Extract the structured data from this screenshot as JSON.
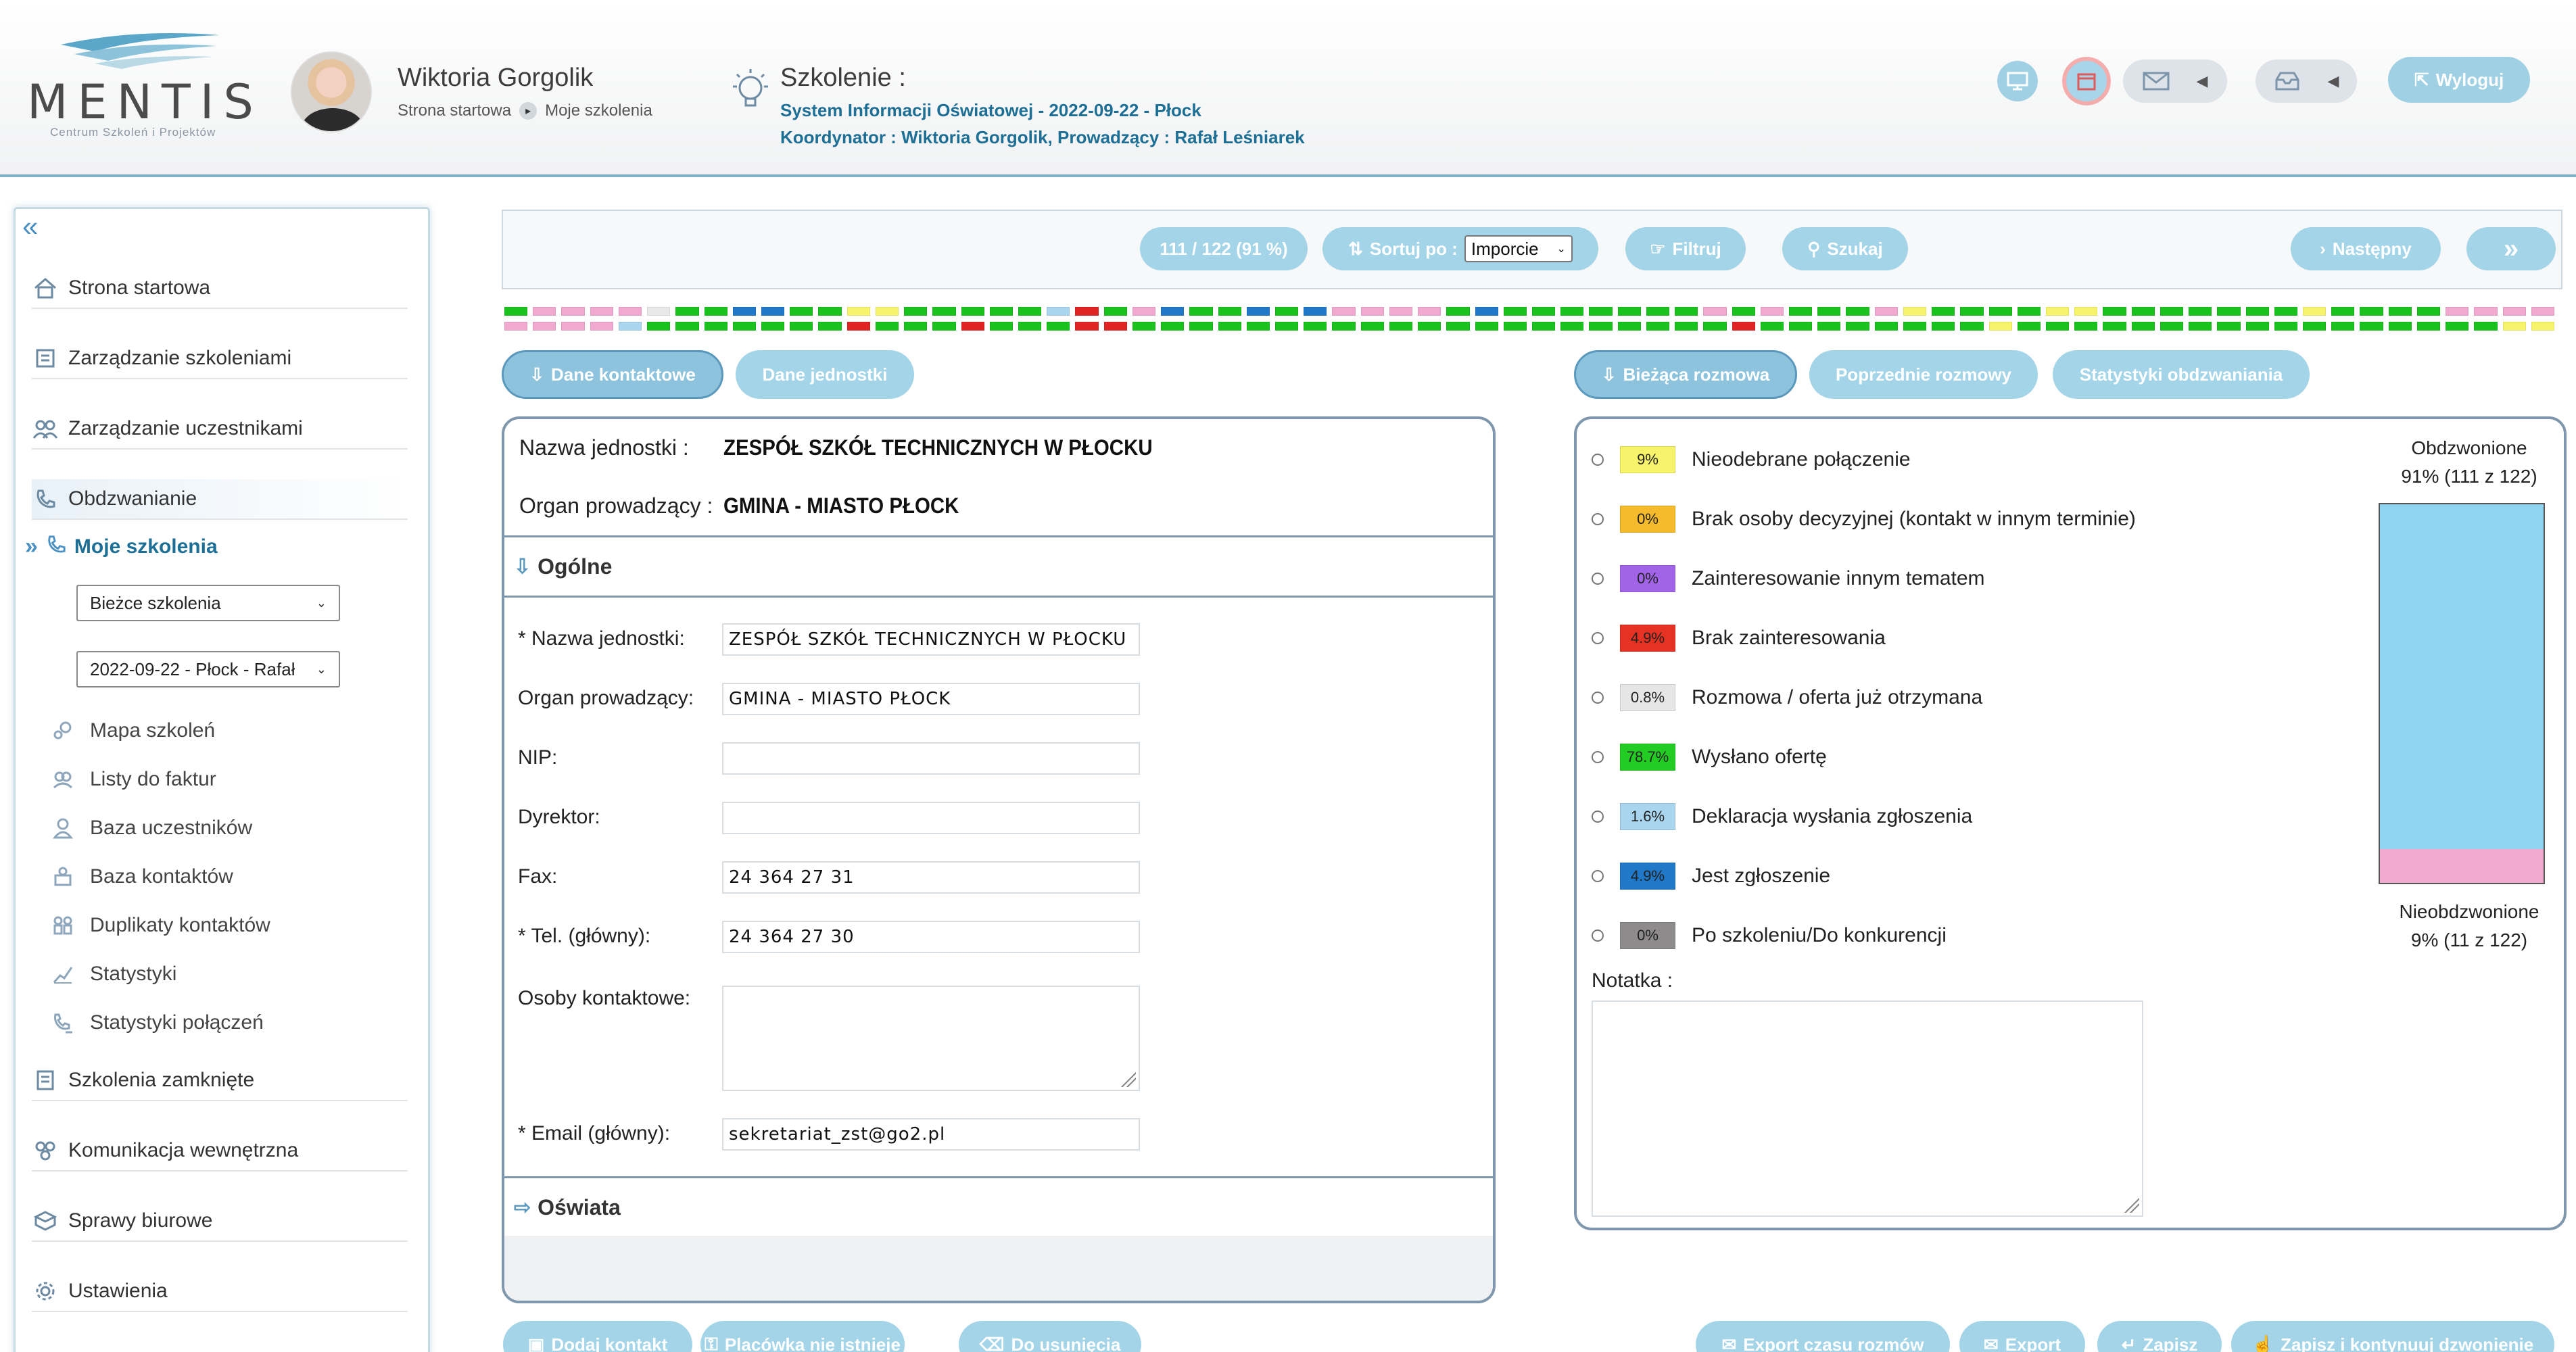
{
  "header": {
    "logo": {
      "word": "MENTIS",
      "tagline": "Centrum Szkoleń i Projektów"
    },
    "user": {
      "name": "Wiktoria Gorgolik",
      "crumbs": [
        "Strona startowa",
        "Moje szkolenia"
      ]
    },
    "course": {
      "label": "Szkolenie :",
      "name": "System Informacji Oświatowej - 2022-09-22 - Płock",
      "coordinator": "Koordynator : Wiktoria Gorgolik, Prowadzący : Rafał Leśniarek"
    },
    "icons": [
      "monitor-icon",
      "calendar-icon",
      "mail-icon",
      "chevron-left-icon",
      "inbox-icon",
      "chevron-left-icon"
    ],
    "logout_label": "Wyloguj"
  },
  "sidebar": {
    "items": [
      {
        "label": "Strona startowa",
        "icon": "home-icon"
      },
      {
        "label": "Zarządzanie szkoleniami",
        "icon": "book-icon"
      },
      {
        "label": "Zarządzanie uczestnikami",
        "icon": "users-icon"
      },
      {
        "label": "Obdzwanianie",
        "icon": "phone-icon"
      }
    ],
    "current": "Moje szkolenia",
    "select_scope": "Bieżce szkolenia",
    "select_course": "2022-09-22 - Płock - Rafał",
    "sub_items": [
      {
        "label": "Mapa szkoleń",
        "icon": "map-icon"
      },
      {
        "label": "Listy do faktur",
        "icon": "list-icon"
      },
      {
        "label": "Baza uczestników",
        "icon": "person-icon"
      },
      {
        "label": "Baza kontaktów",
        "icon": "contacts-icon"
      },
      {
        "label": "Duplikaty kontaktów",
        "icon": "duplicate-icon"
      },
      {
        "label": "Statystyki",
        "icon": "chart-icon"
      },
      {
        "label": "Statystyki połączeń",
        "icon": "call-stats-icon"
      }
    ],
    "bottom_items": [
      {
        "label": "Szkolenia zamknięte",
        "icon": "archive-icon"
      },
      {
        "label": "Komunikacja wewnętrzna",
        "icon": "chat-icon"
      },
      {
        "label": "Sprawy biurowe",
        "icon": "box-icon"
      },
      {
        "label": "Ustawienia",
        "icon": "gear-icon"
      }
    ]
  },
  "toolbar": {
    "progress": "111 / 122 (91 %)",
    "sort_label": "Sortuj po :",
    "sort_value": "Imporcie",
    "filter_label": "Filtruj",
    "search_label": "Szukaj",
    "next_label": "Następny"
  },
  "strip": {
    "colors": {
      "g": "#19c21c",
      "p": "#f2a9cf",
      "w": "#e9e9e9",
      "b": "#1f78c8",
      "y": "#f7f36b",
      "l": "#a9d5ef",
      "r": "#e02424"
    },
    "row1": "gppppwggbbggyyggggglrgpbggbgbppppgbgggggggpgpgggpyggggyygggggggyggggppppgpg",
    "row2": "pppplgggggggrgggrgggrrgggggggggggggggggggggrggggggggygggggggggggggggggyybgg"
  },
  "tabs": {
    "left": [
      "Dane kontaktowe",
      "Dane jednostki"
    ],
    "right": [
      "Bieżąca rozmowa",
      "Poprzednie rozmowy",
      "Statystyki obdzwaniania"
    ]
  },
  "unit": {
    "name_label": "Nazwa jednostki :",
    "name_value": "ZESPÓŁ SZKÓŁ TECHNICZNYCH W PŁOCKU",
    "organ_label": "Organ prowadzący :",
    "organ_value": "GMINA - MIASTO PŁOCK",
    "section_general": "Ogólne",
    "section_education": "Oświata"
  },
  "form": {
    "name_label": "* Nazwa jednostki:",
    "name_value": "ZESPÓŁ SZKÓŁ TECHNICZNYCH W PŁOCKU",
    "organ_label": "Organ prowadzący:",
    "organ_value": "GMINA - MIASTO PŁOCK",
    "nip_label": "NIP:",
    "nip_value": "",
    "director_label": "Dyrektor:",
    "director_value": "",
    "fax_label": "Fax:",
    "fax_value": "24 364 27 31",
    "phone_label": "* Tel. (główny):",
    "phone_value": "24 364 27 30",
    "contacts_label": "Osoby kontaktowe:",
    "email_label": "* Email (główny):",
    "email_value": "sekretariat_zst@go2.pl"
  },
  "status": [
    {
      "pct": "9%",
      "label": "Nieodebrane połączenie",
      "color": "#f7f36b"
    },
    {
      "pct": "0%",
      "label": "Brak osoby decyzyjnej (kontakt w innym terminie)",
      "color": "#f6bb2d"
    },
    {
      "pct": "0%",
      "label": "Zainteresowanie innym tematem",
      "color": "#a163e8"
    },
    {
      "pct": "4.9%",
      "label": "Brak zainteresowania",
      "color": "#e63222"
    },
    {
      "pct": "0.8%",
      "label": "Rozmowa / oferta już otrzymana",
      "color": "#e6e6e6"
    },
    {
      "pct": "78.7%",
      "label": "Wysłano ofertę",
      "color": "#22cc22"
    },
    {
      "pct": "1.6%",
      "label": "Deklaracja wysłania zgłoszenia",
      "color": "#a9d5ef"
    },
    {
      "pct": "4.9%",
      "label": "Jest zgłoszenie",
      "color": "#1f78c8"
    },
    {
      "pct": "0%",
      "label": "Po szkoleniu/Do konkurencji",
      "color": "#8d8b8b"
    }
  ],
  "note_label": "Notatka :",
  "called": {
    "title": "Obdzwonione",
    "value": "91% (111 z 122)",
    "fraction": 0.91
  },
  "uncalled": {
    "title": "Nieobdzwonione",
    "value": "9% (11 z 122)"
  },
  "bottom": {
    "add_contact": "Dodaj kontakt",
    "no_facility": "Placówka nie istnieje",
    "to_delete": "Do usunięcia",
    "export_time": "Export czasu rozmów",
    "export": "Export",
    "save": "Zapisz",
    "save_continue": "Zapisz i kontynuuj dzwonienie"
  }
}
